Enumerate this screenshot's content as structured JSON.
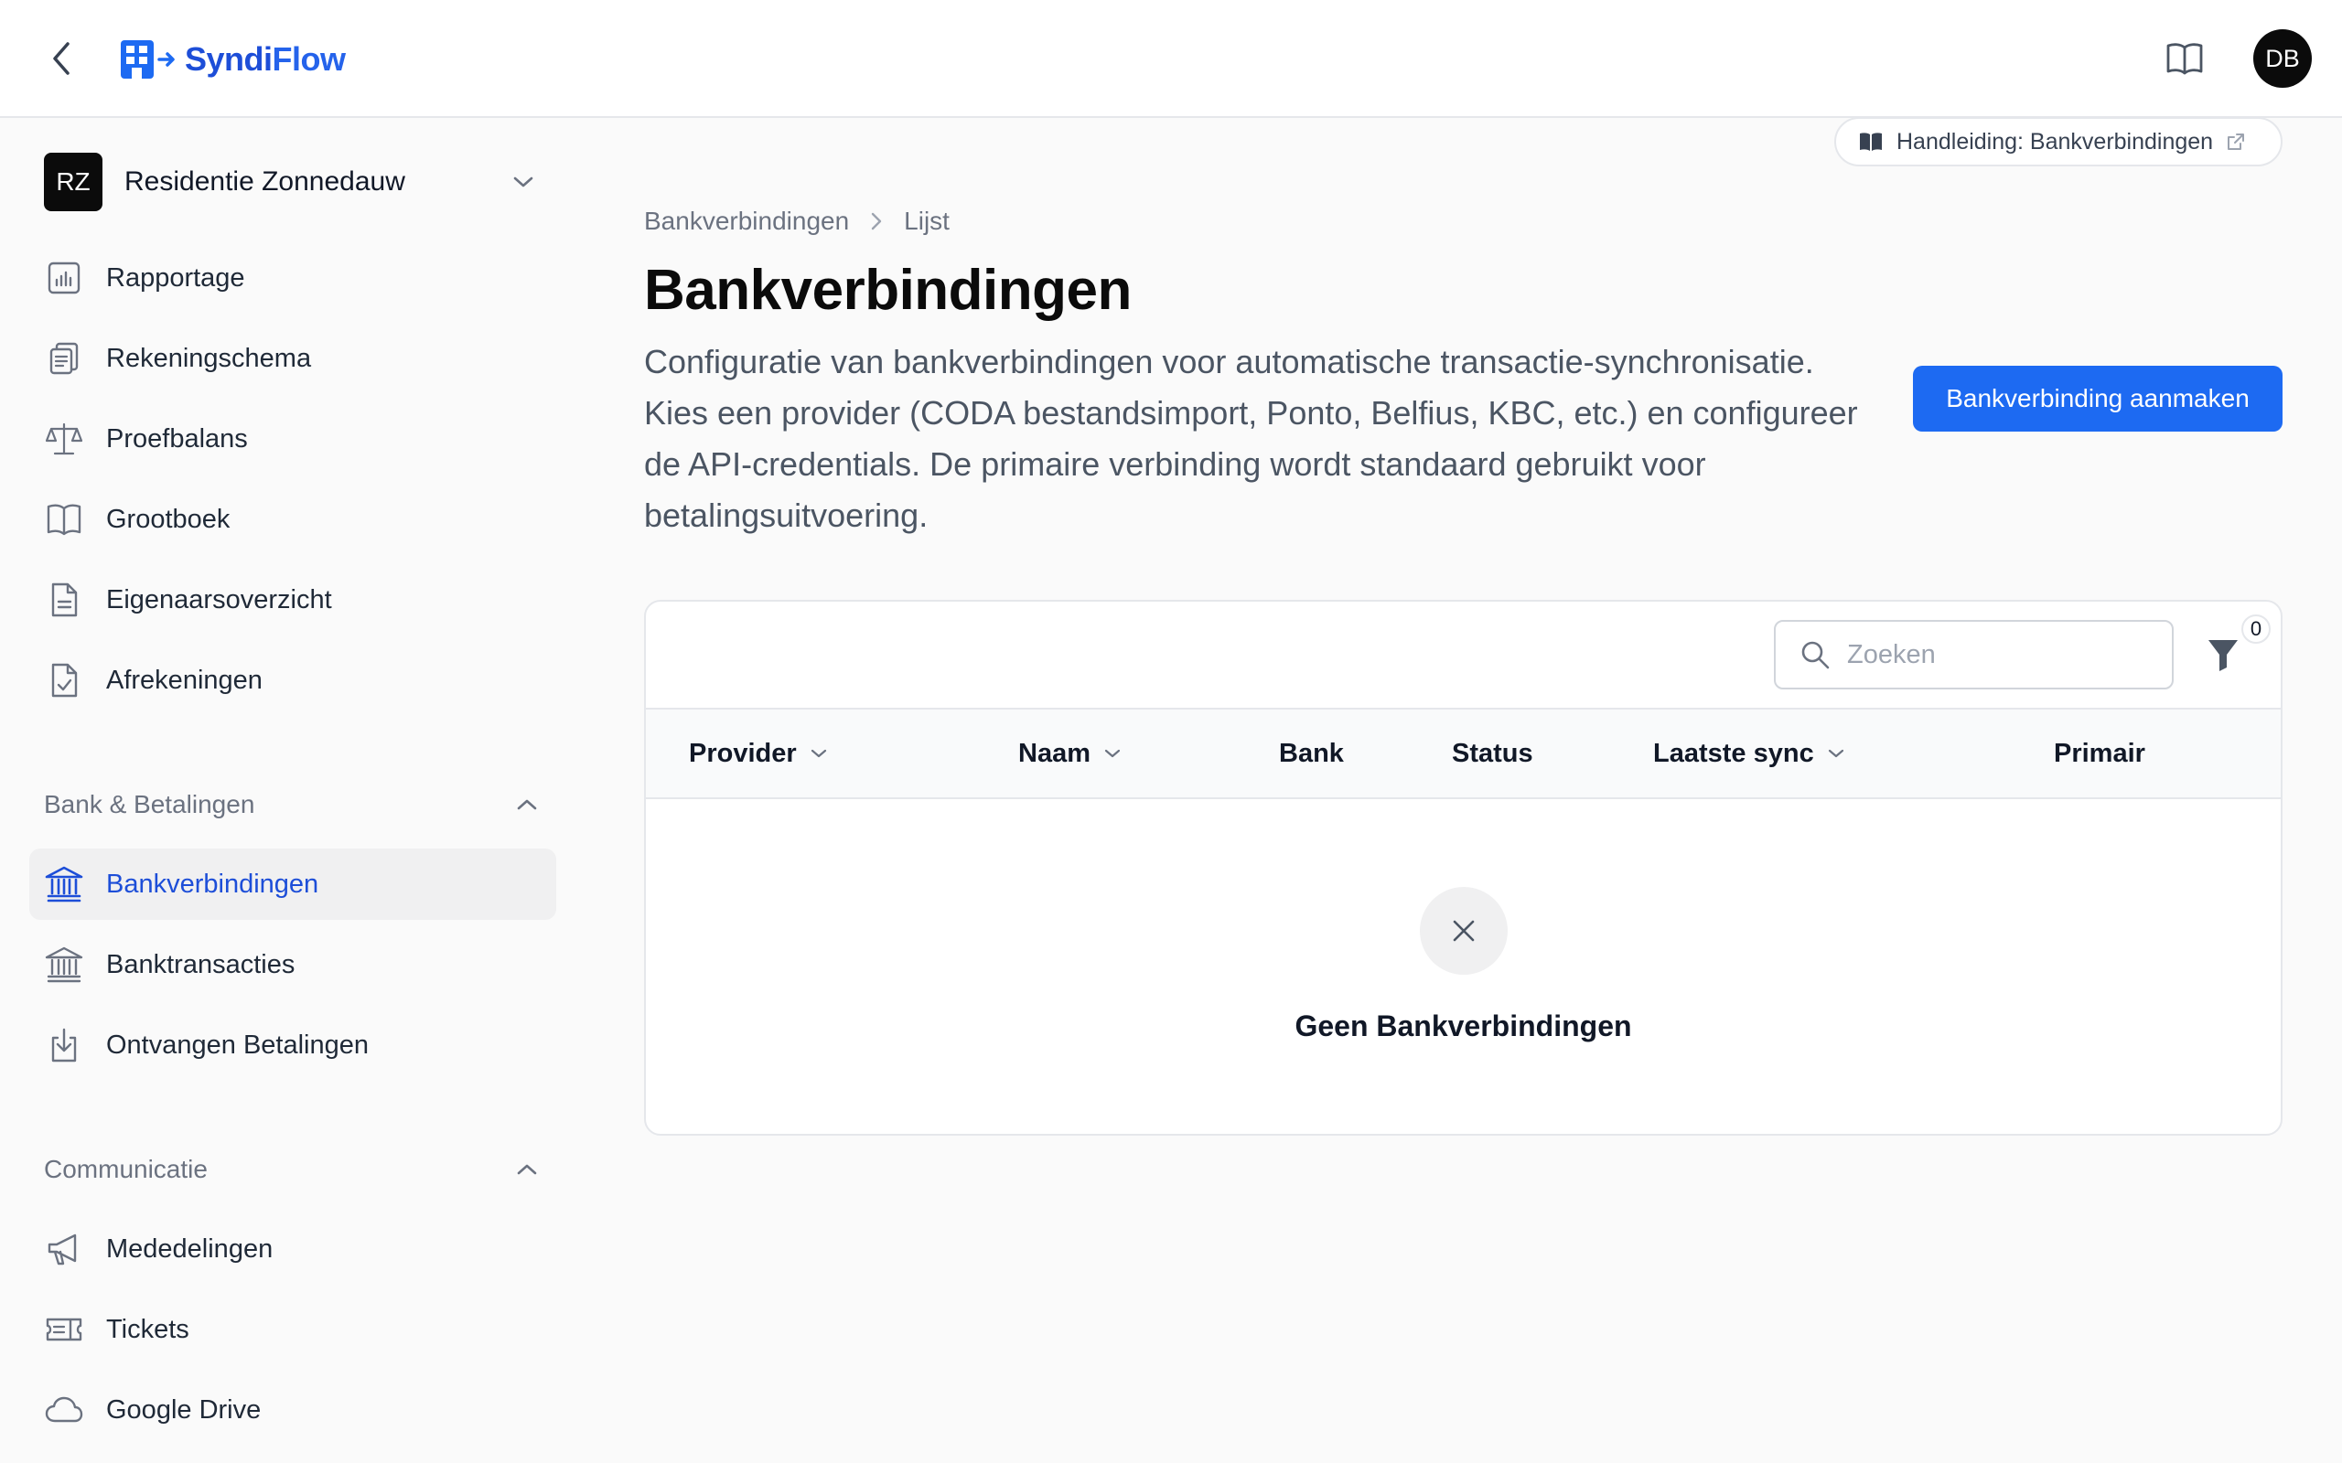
{
  "app": {
    "name_part1": "Syndi",
    "name_part2": "Flow",
    "user_initials": "DB",
    "accent": "#1d6af2"
  },
  "tenant": {
    "initials": "RZ",
    "name": "Residentie Zonnedauw"
  },
  "sidebar": {
    "items": [
      {
        "label": "Rapportage",
        "icon": "bar-chart-icon"
      },
      {
        "label": "Rekeningschema",
        "icon": "clipboard-list-icon"
      },
      {
        "label": "Proefbalans",
        "icon": "scale-icon"
      },
      {
        "label": "Grootboek",
        "icon": "book-open-icon"
      },
      {
        "label": "Eigenaarsoverzicht",
        "icon": "document-text-icon"
      },
      {
        "label": "Afrekeningen",
        "icon": "document-check-icon"
      }
    ],
    "sections": [
      {
        "title": "Bank & Betalingen",
        "items": [
          {
            "label": "Bankverbindingen",
            "icon": "bank-icon",
            "active": true
          },
          {
            "label": "Banktransacties",
            "icon": "bank-icon"
          },
          {
            "label": "Ontvangen Betalingen",
            "icon": "download-icon"
          }
        ]
      },
      {
        "title": "Communicatie",
        "items": [
          {
            "label": "Mededelingen",
            "icon": "megaphone-icon"
          },
          {
            "label": "Tickets",
            "icon": "ticket-icon"
          },
          {
            "label": "Google Drive",
            "icon": "cloud-icon"
          }
        ]
      }
    ]
  },
  "guide": {
    "label": "Handleiding: Bankverbindingen"
  },
  "breadcrumb": {
    "parent": "Bankverbindingen",
    "current": "Lijst"
  },
  "page": {
    "title": "Bankverbindingen",
    "description": "Configuratie van bankverbindingen voor automatische transactie-synchronisatie. Kies een provider (CODA bestandsimport, Ponto, Belfius, KBC, etc.) en configureer de API-credentials. De primaire verbinding wordt standaard gebruikt voor betalingsuitvoering.",
    "create_button": "Bankverbinding aanmaken"
  },
  "table": {
    "search_placeholder": "Zoeken",
    "filter_count": "0",
    "columns": [
      {
        "label": "Provider",
        "sortable": true
      },
      {
        "label": "Naam",
        "sortable": true
      },
      {
        "label": "Bank",
        "sortable": false
      },
      {
        "label": "Status",
        "sortable": false
      },
      {
        "label": "Laatste sync",
        "sortable": true
      },
      {
        "label": "Primair",
        "sortable": false
      }
    ],
    "empty_text": "Geen Bankverbindingen"
  }
}
